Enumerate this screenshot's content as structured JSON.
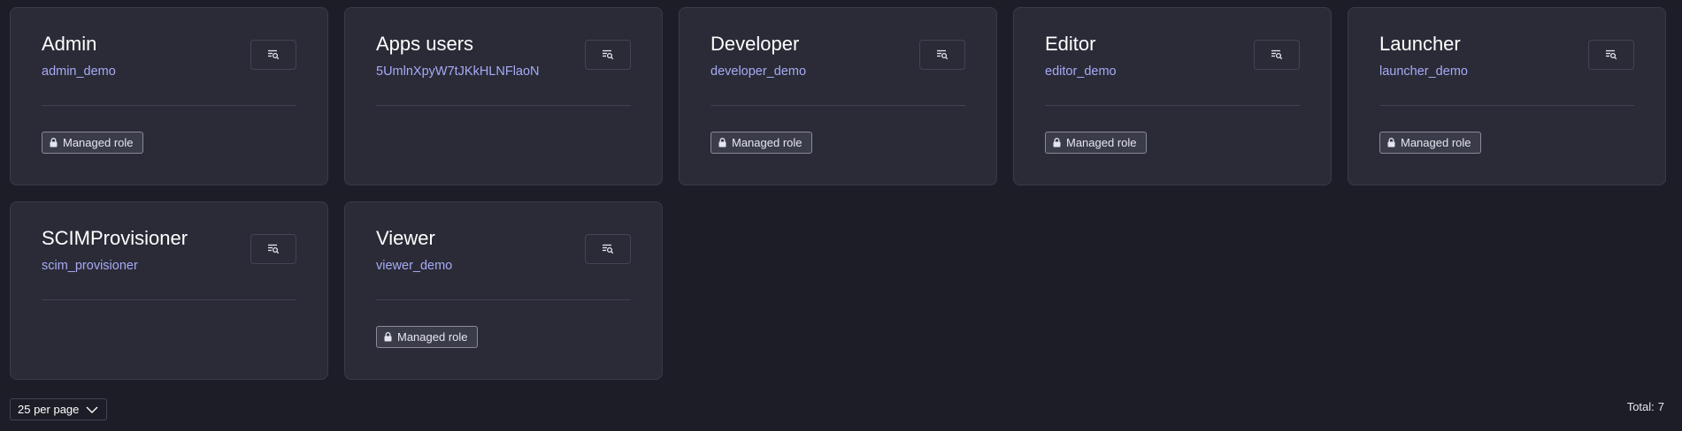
{
  "cards": [
    {
      "title": "Admin",
      "subtitle": "admin_demo",
      "badge": "Managed role"
    },
    {
      "title": "Apps users",
      "subtitle": "5UmlnXpyW7tJKkHLNFlaoN",
      "badge": ""
    },
    {
      "title": "Developer",
      "subtitle": "developer_demo",
      "badge": "Managed role"
    },
    {
      "title": "Editor",
      "subtitle": "editor_demo",
      "badge": "Managed role"
    },
    {
      "title": "Launcher",
      "subtitle": "launcher_demo",
      "badge": "Managed role"
    },
    {
      "title": "SCIMProvisioner",
      "subtitle": "scim_provisioner",
      "badge": ""
    },
    {
      "title": "Viewer",
      "subtitle": "viewer_demo",
      "badge": "Managed role"
    }
  ],
  "icons": {
    "card_button": "filter-search-icon",
    "badge": "lock-icon",
    "pager": "chevron-down-icon"
  },
  "pagination": {
    "per_page_label": "25 per page"
  },
  "footer": {
    "total_label": "Total:",
    "total_value": "7"
  },
  "colors": {
    "background": "#1c1d26",
    "card": "#2a2b37",
    "subtitle": "#a8aaf5"
  }
}
